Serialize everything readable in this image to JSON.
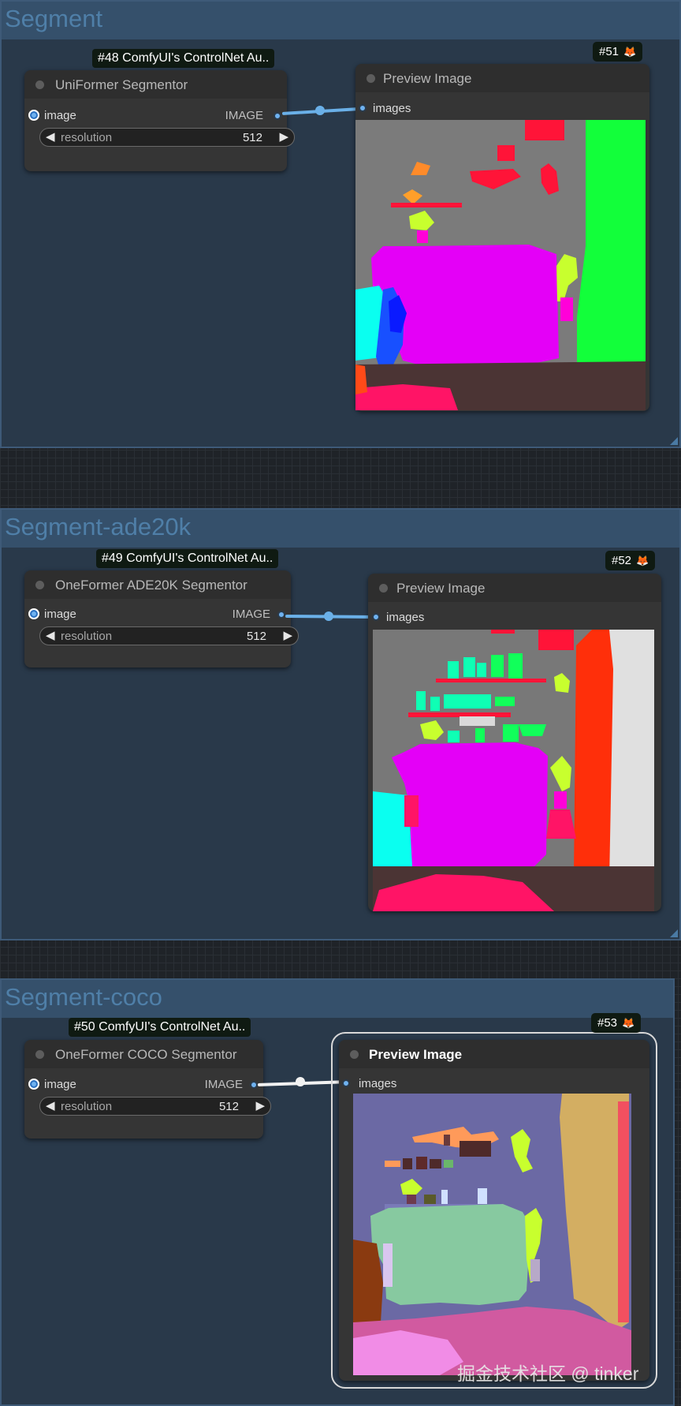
{
  "groups": [
    {
      "title": "Segment"
    },
    {
      "title": "Segment-ade20k"
    },
    {
      "title": "Segment-coco"
    }
  ],
  "nodes": {
    "n48": {
      "badge": "#48 ComfyUI's ControlNet Au..",
      "title": "UniFormer Segmentor",
      "input": "image",
      "output": "IMAGE",
      "widget_label": "resolution",
      "widget_value": "512"
    },
    "n49": {
      "badge": "#49 ComfyUI's ControlNet Au..",
      "title": "OneFormer ADE20K Segmentor",
      "input": "image",
      "output": "IMAGE",
      "widget_label": "resolution",
      "widget_value": "512"
    },
    "n50": {
      "badge": "#50 ComfyUI's ControlNet Au..",
      "title": "OneFormer COCO Segmentor",
      "input": "image",
      "output": "IMAGE",
      "widget_label": "resolution",
      "widget_value": "512"
    },
    "n51": {
      "badge": "#51",
      "title": "Preview Image",
      "input": "images"
    },
    "n52": {
      "badge": "#52",
      "title": "Preview Image",
      "input": "images"
    },
    "n53": {
      "badge": "#53",
      "title": "Preview Image",
      "input": "images"
    }
  },
  "icons": {
    "badge_icon": "fox-icon",
    "arrow_left": "triangle-left-icon",
    "arrow_right": "triangle-right-icon"
  },
  "colors": {
    "group_bg": "#29394a",
    "group_header": "#35506b",
    "group_title": "#4f7fa8",
    "node_bg": "#353535",
    "link": "#6ab0e8",
    "selected_link": "#ffffff"
  },
  "watermark": "掘金技术社区 @ tinker"
}
